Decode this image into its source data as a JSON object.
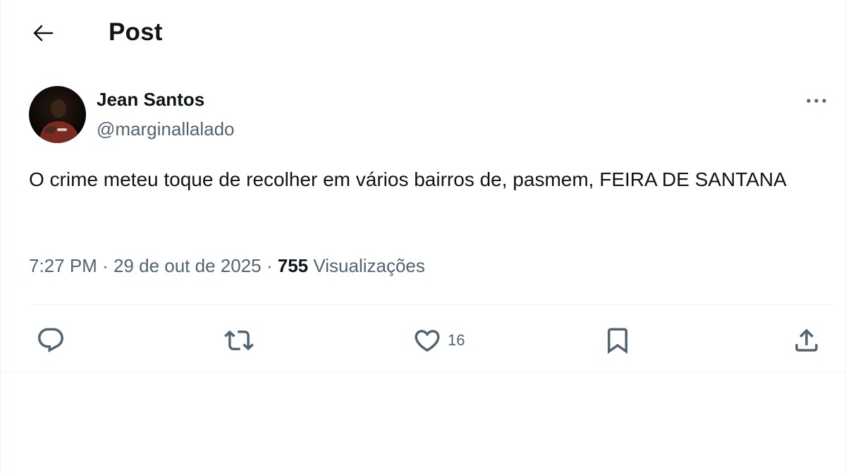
{
  "header": {
    "back_icon": "arrow-left-icon",
    "title": "Post"
  },
  "author": {
    "avatar_icon": "profile-photo",
    "name": "Jean Santos",
    "handle": "@marginallalado"
  },
  "post": {
    "text": "O crime meteu toque de recolher em vários bairros de, pasmem, FEIRA DE SANTANA",
    "time": "7:27 PM",
    "date": "29 de out de 2025",
    "separator": "·",
    "views_count": "755",
    "views_label": "Visualizações"
  },
  "actions": {
    "reply_icon": "reply-icon",
    "repost_icon": "repost-icon",
    "like_icon": "heart-icon",
    "like_count": "16",
    "bookmark_icon": "bookmark-icon",
    "share_icon": "share-icon"
  },
  "colors": {
    "text_primary": "#0f1419",
    "text_secondary": "#536471",
    "divider": "#eff3f4"
  }
}
